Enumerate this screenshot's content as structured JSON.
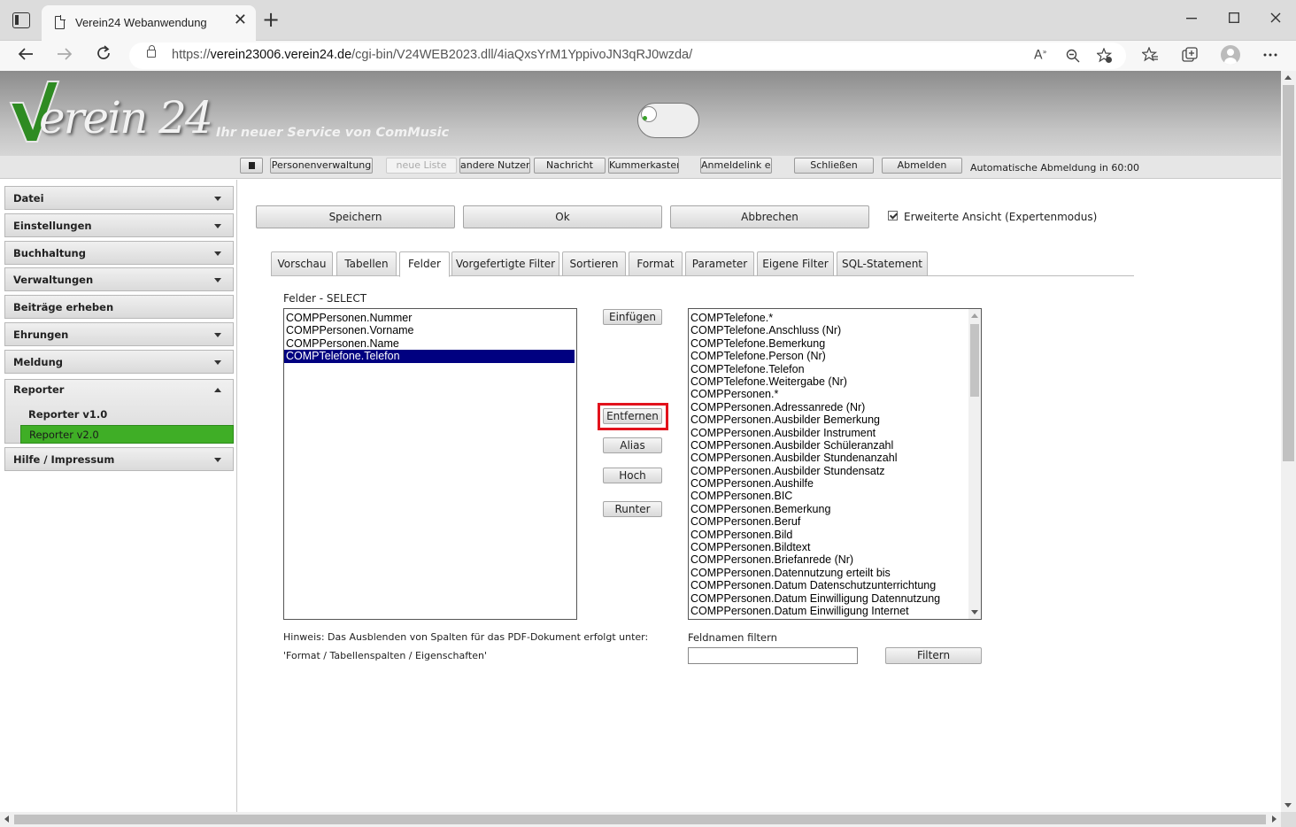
{
  "browser": {
    "tab_title": "Verein24 Webanwendung",
    "new_tab_glyph": "+",
    "close_glyph": "✕",
    "url_prefix": "https://",
    "url_domain": "verein23006.verein24.de",
    "url_path": "/cgi-bin/V24WEB2023.dll/4iaQxsYrM1YppivoJN3qRJ0wzda/",
    "icons": [
      "tab-actions-icon",
      "back-icon",
      "forward-icon",
      "refresh-icon",
      "lock-icon",
      "read-aloud-icon",
      "zoom-icon",
      "add-favorite-icon",
      "favorites-icon",
      "collections-icon",
      "profile-icon",
      "more-icon",
      "minimize-icon",
      "maximize-icon",
      "close-window-icon"
    ]
  },
  "banner": {
    "logo_text": "erein 24",
    "slogan": "Ihr neuer Service von ComMusic"
  },
  "toolbar": {
    "buttons": [
      "Personenverwaltung",
      "neue Liste",
      "andere Nutzer",
      "Nachricht",
      "Kummerkasten",
      "Anmeldelink erst",
      "Schließen",
      "Abmelden"
    ],
    "auto_logout": "Automatische Abmeldung in 60:00"
  },
  "sidebar": {
    "items": [
      "Datei",
      "Einstellungen",
      "Buchhaltung",
      "Verwaltungen",
      "Beiträge erheben",
      "Ehrungen",
      "Meldung",
      "Reporter",
      "Hilfe / Impressum"
    ],
    "reporter_sub": [
      "Reporter v1.0",
      "Reporter v2.0"
    ],
    "active_sub": "Reporter v2.0",
    "accent": "#3fae26"
  },
  "actions": {
    "save": "Speichern",
    "ok": "Ok",
    "cancel": "Abbrechen",
    "expert_label": "Erweiterte Ansicht (Expertenmodus)",
    "expert_checked": true
  },
  "tabs": [
    "Vorschau",
    "Tabellen",
    "Felder",
    "Vorgefertigte Filter",
    "Sortieren",
    "Format",
    "Parameter",
    "Eigene Filter",
    "SQL-Statement"
  ],
  "active_tab": "Felder",
  "felder": {
    "label": "Felder - SELECT",
    "selected_fields": [
      "COMPPersonen.Nummer",
      "COMPPersonen.Vorname",
      "COMPPersonen.Name",
      "COMPTelefone.Telefon"
    ],
    "selected_item": "COMPTelefone.Telefon",
    "buttons": [
      "Einfügen",
      "Entfernen",
      "Alias",
      "Hoch",
      "Runter"
    ],
    "highlighted_button": "Entfernen",
    "available_fields": [
      "COMPTelefone.*",
      "COMPTelefone.Anschluss (Nr)",
      "COMPTelefone.Bemerkung",
      "COMPTelefone.Person (Nr)",
      "COMPTelefone.Telefon",
      "COMPTelefone.Weitergabe (Nr)",
      "COMPPersonen.*",
      "COMPPersonen.Adressanrede (Nr)",
      "COMPPersonen.Ausbilder Bemerkung",
      "COMPPersonen.Ausbilder Instrument",
      "COMPPersonen.Ausbilder Schüleranzahl",
      "COMPPersonen.Ausbilder Stundenanzahl",
      "COMPPersonen.Ausbilder Stundensatz",
      "COMPPersonen.Aushilfe",
      "COMPPersonen.BIC",
      "COMPPersonen.Bemerkung",
      "COMPPersonen.Beruf",
      "COMPPersonen.Bild",
      "COMPPersonen.Bildtext",
      "COMPPersonen.Briefanrede (Nr)",
      "COMPPersonen.Datennutzung erteilt bis",
      "COMPPersonen.Datum Datenschutzunterrichtung",
      "COMPPersonen.Datum Einwilligung Datennutzung",
      "COMPPersonen.Datum Einwilligung Internet"
    ],
    "hint_line1": "Hinweis: Das Ausblenden von Spalten für das PDF-Dokument erfolgt unter:",
    "hint_line2": "'Format / Tabellenspalten / Eigenschaften'",
    "filter_label": "Feldnamen filtern",
    "filter_value": "",
    "filter_button": "Filtern"
  }
}
